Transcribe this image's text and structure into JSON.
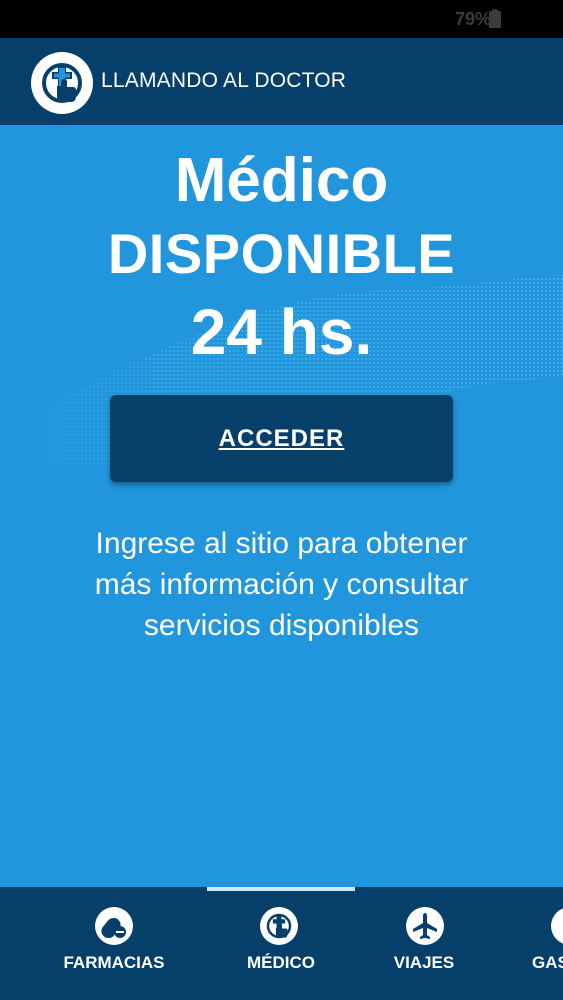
{
  "status_bar": {
    "battery_level": "79%"
  },
  "app_bar": {
    "title": "LLAMANDO AL DOCTOR",
    "logo_icon": "hand-cross-icon"
  },
  "hero": {
    "line1": "Médico",
    "line2": "DISPONIBLE",
    "line3": "24 hs."
  },
  "access_button": {
    "label": "ACCEDER"
  },
  "description": "Ingrese al sitio para obtener más información y consultar servicios disponibles",
  "bottom_nav": {
    "items": [
      {
        "label": "FARMACIAS",
        "icon": "pills-icon"
      },
      {
        "label": "MÉDICO",
        "icon": "hand-cross-icon"
      },
      {
        "label": "VIAJES",
        "icon": "airplane-icon"
      },
      {
        "label": "GAS",
        "icon": "gas-icon"
      }
    ],
    "selected": "MÉDICO"
  },
  "colors": {
    "primary_dark": "#063f69",
    "background": "#2196dd",
    "text": "#ffffff"
  }
}
